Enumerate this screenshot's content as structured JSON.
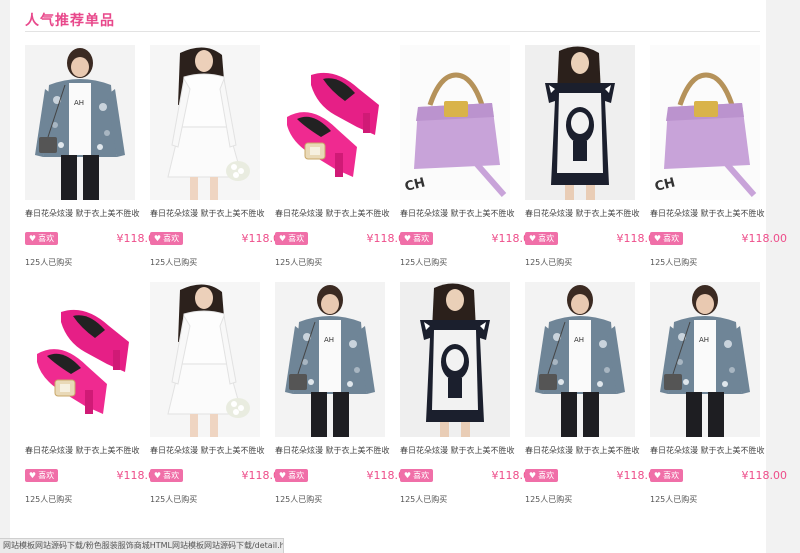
{
  "section": {
    "title": "人气推荐单品"
  },
  "products": [
    {
      "name": "春日花朵炫漫 默于衣上美不胜收",
      "price": "¥118.00",
      "like": "喜欢",
      "sold": "125人已购买",
      "image": "floral-jacket"
    },
    {
      "name": "春日花朵炫漫 默于衣上美不胜收",
      "price": "¥118.00",
      "like": "喜欢",
      "sold": "125人已购买",
      "image": "white-dress"
    },
    {
      "name": "春日花朵炫漫 默于衣上美不胜收",
      "price": "¥118.00",
      "like": "喜欢",
      "sold": "125人已购买",
      "image": "pink-shoes"
    },
    {
      "name": "春日花朵炫漫 默于衣上美不胜收",
      "price": "¥118.00",
      "like": "喜欢",
      "sold": "125人已购买",
      "image": "purple-bag"
    },
    {
      "name": "春日花朵炫漫 默于衣上美不胜收",
      "price": "¥118.00",
      "like": "喜欢",
      "sold": "125人已购买",
      "image": "graphic-tee-dress"
    },
    {
      "name": "春日花朵炫漫 默于衣上美不胜收",
      "price": "¥118.00",
      "like": "喜欢",
      "sold": "125人已购买",
      "image": "purple-bag"
    },
    {
      "name": "春日花朵炫漫 默于衣上美不胜收",
      "price": "¥118.00",
      "like": "喜欢",
      "sold": "125人已购买",
      "image": "pink-shoes"
    },
    {
      "name": "春日花朵炫漫 默于衣上美不胜收",
      "price": "¥118.00",
      "like": "喜欢",
      "sold": "125人已购买",
      "image": "white-dress"
    },
    {
      "name": "春日花朵炫漫 默于衣上美不胜收",
      "price": "¥118.00",
      "like": "喜欢",
      "sold": "125人已购买",
      "image": "floral-jacket"
    },
    {
      "name": "春日花朵炫漫 默于衣上美不胜收",
      "price": "¥118.00",
      "like": "喜欢",
      "sold": "125人已购买",
      "image": "graphic-tee-dress"
    },
    {
      "name": "春日花朵炫漫 默于衣上美不胜收",
      "price": "¥118.00",
      "like": "喜欢",
      "sold": "125人已购买",
      "image": "floral-jacket"
    },
    {
      "name": "春日花朵炫漫 默于衣上美不胜收",
      "price": "¥118.00",
      "like": "喜欢",
      "sold": "125人已购买",
      "image": "floral-jacket"
    }
  ],
  "status_bar": {
    "text": "网站模板网站源码下载/粉色服装服饰商城HTML网站模板网站源码下载/detail.html"
  },
  "colors": {
    "accent": "#e8488b",
    "like_button": "#f06fa8",
    "price": "#ee4d8a"
  }
}
